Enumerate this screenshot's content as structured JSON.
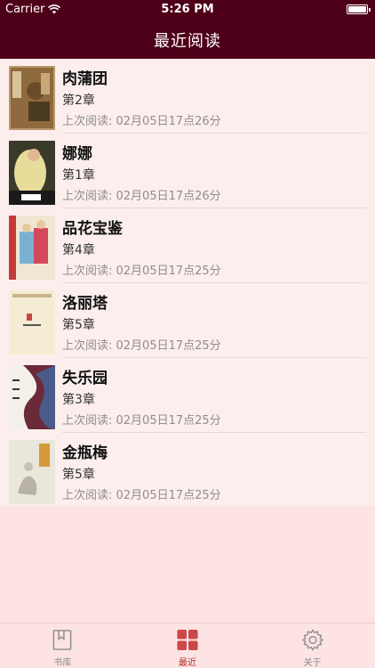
{
  "status_bar": {
    "carrier": "Carrier",
    "time": "5:26 PM"
  },
  "nav": {
    "title": "最近阅读"
  },
  "colors": {
    "nav_bg": "#4f0019",
    "accent": "#b32a2a"
  },
  "books": [
    {
      "title": "肉蒲团",
      "chapter": "第2章",
      "last_read": "上次阅读: 02月05日17点26分",
      "cover_icon": "book-cover-icon"
    },
    {
      "title": "娜娜",
      "chapter": "第1章",
      "last_read": "上次阅读: 02月05日17点26分",
      "cover_icon": "book-cover-icon"
    },
    {
      "title": "品花宝鉴",
      "chapter": "第4章",
      "last_read": "上次阅读: 02月05日17点25分",
      "cover_icon": "book-cover-icon"
    },
    {
      "title": "洛丽塔",
      "chapter": "第5章",
      "last_read": "上次阅读: 02月05日17点25分",
      "cover_icon": "book-cover-icon"
    },
    {
      "title": "失乐园",
      "chapter": "第3章",
      "last_read": "上次阅读: 02月05日17点25分",
      "cover_icon": "book-cover-icon"
    },
    {
      "title": "金瓶梅",
      "chapter": "第5章",
      "last_read": "上次阅读: 02月05日17点25分",
      "cover_icon": "book-cover-icon"
    }
  ],
  "tabs": [
    {
      "label": "书库",
      "icon": "bookmark-book-icon",
      "active": false
    },
    {
      "label": "最近",
      "icon": "grid-icon",
      "active": true
    },
    {
      "label": "关于",
      "icon": "gear-icon",
      "active": false
    }
  ]
}
